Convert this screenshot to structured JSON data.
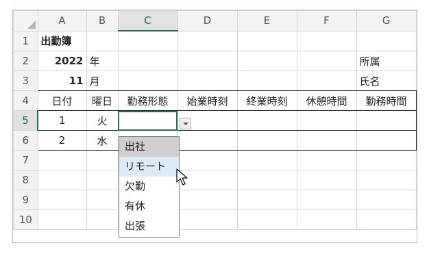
{
  "columns": [
    "A",
    "B",
    "C",
    "D",
    "E",
    "F",
    "G"
  ],
  "rows": [
    "1",
    "2",
    "3",
    "4",
    "5",
    "6",
    "7",
    "8",
    "9",
    "10"
  ],
  "cells": {
    "A1": "出勤簿",
    "A2": "2022",
    "B2": "年",
    "A3": "11",
    "B3": "月",
    "G2": "所属",
    "G3": "氏名",
    "A4": "日付",
    "B4": "曜日",
    "C4": "勤務形態",
    "D4": "始業時刻",
    "E4": "終業時刻",
    "F4": "休憩時間",
    "G4": "勤務時間",
    "A5": "1",
    "B5": "火",
    "A6": "2",
    "B6": "水"
  },
  "selection": {
    "cell": "C5",
    "column": "C",
    "row": "5"
  },
  "dropdown": {
    "options": [
      "出社",
      "リモート",
      "欠勤",
      "有休",
      "出張"
    ],
    "selected_index": 0,
    "hover_index": 1
  },
  "colors": {
    "accent": "#217346",
    "hover": "#dbeaf7",
    "selected": "#cfcfcf"
  }
}
